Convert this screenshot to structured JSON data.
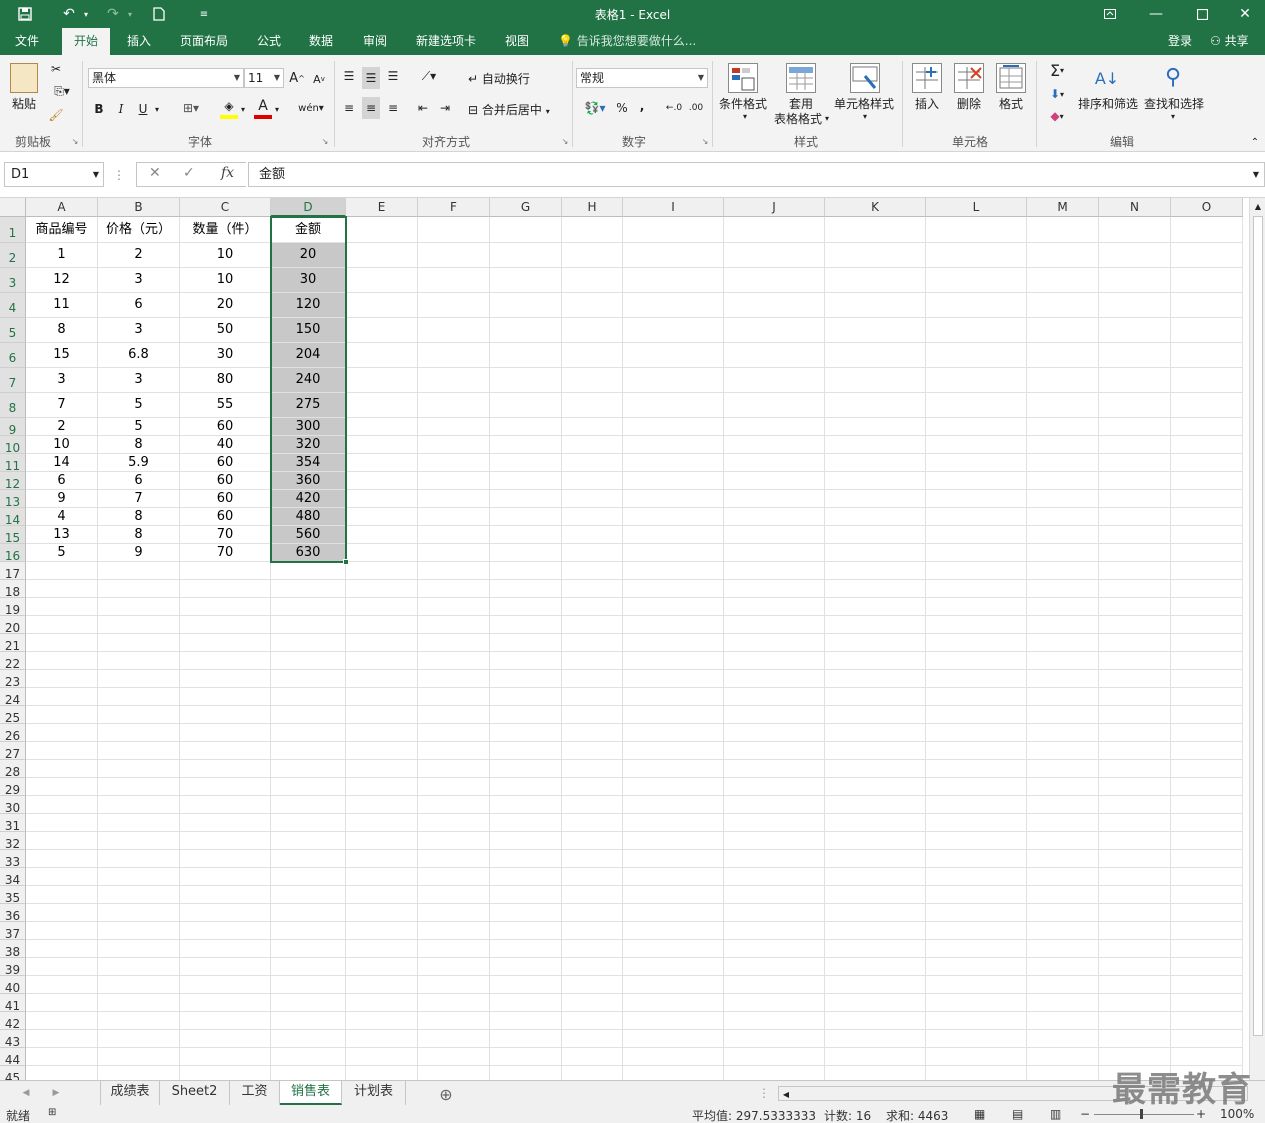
{
  "window": {
    "title": "表格1 - Excel",
    "icons": [
      "save-icon",
      "undo-icon",
      "redo-icon",
      "new-document-icon",
      "customize-icon"
    ],
    "controls": [
      "restore-ribbon-icon",
      "minimize-icon",
      "maximize-icon",
      "close-icon"
    ]
  },
  "tabs": [
    "文件",
    "开始",
    "插入",
    "页面布局",
    "公式",
    "数据",
    "审阅",
    "新建选项卡",
    "视图"
  ],
  "active_tab": "开始",
  "tell_me": "告诉我您想要做什么...",
  "login": "登录",
  "share": "共享",
  "ribbon": {
    "clipboard": {
      "paste": "粘贴",
      "label": "剪贴板"
    },
    "font": {
      "name": "黑体",
      "size": "11",
      "bold": "B",
      "italic": "I",
      "underline": "U",
      "label": "字体"
    },
    "align": {
      "wrap": "自动换行",
      "merge": "合并后居中",
      "label": "对齐方式"
    },
    "number": {
      "format": "常规",
      "percent": "%",
      "comma": ",",
      "label": "数字"
    },
    "styles": {
      "cond": "条件格式",
      "table1": "套用",
      "table2": "表格格式",
      "cell": "单元格样式",
      "label": "样式"
    },
    "cells": {
      "insert": "插入",
      "delete": "删除",
      "format": "格式",
      "label": "单元格"
    },
    "edit": {
      "sort": "排序和筛选",
      "find": "查找和选择",
      "label": "编辑"
    }
  },
  "formula_bar": {
    "name_box": "D1",
    "fx": "fx",
    "cancel": "✕",
    "enter": "✓",
    "content": "金额"
  },
  "columns": [
    "A",
    "B",
    "C",
    "D",
    "E",
    "F",
    "G",
    "H",
    "I",
    "J",
    "K",
    "L",
    "M",
    "N",
    "O"
  ],
  "rows": [
    [
      "商品编号",
      "价格（元）",
      "数量（件）",
      "金额"
    ],
    [
      "1",
      "2",
      "10",
      "20"
    ],
    [
      "12",
      "3",
      "10",
      "30"
    ],
    [
      "11",
      "6",
      "20",
      "120"
    ],
    [
      "8",
      "3",
      "50",
      "150"
    ],
    [
      "15",
      "6.8",
      "30",
      "204"
    ],
    [
      "3",
      "3",
      "80",
      "240"
    ],
    [
      "7",
      "5",
      "55",
      "275"
    ],
    [
      "2",
      "5",
      "60",
      "300"
    ],
    [
      "10",
      "8",
      "40",
      "320"
    ],
    [
      "14",
      "5.9",
      "60",
      "354"
    ],
    [
      "6",
      "6",
      "60",
      "360"
    ],
    [
      "9",
      "7",
      "60",
      "420"
    ],
    [
      "4",
      "8",
      "60",
      "480"
    ],
    [
      "13",
      "8",
      "70",
      "560"
    ],
    [
      "5",
      "9",
      "70",
      "630"
    ]
  ],
  "row_numbers_visible": 45,
  "sheets": [
    "成绩表",
    "Sheet2",
    "工资",
    "销售表",
    "计划表"
  ],
  "active_sheet": "销售表",
  "status": {
    "ready": "就绪",
    "average": "平均值: 297.5333333",
    "count": "计数: 16",
    "sum": "求和: 4463",
    "zoom": "100%"
  },
  "watermark": "最需教育",
  "accent_color": "#217346"
}
